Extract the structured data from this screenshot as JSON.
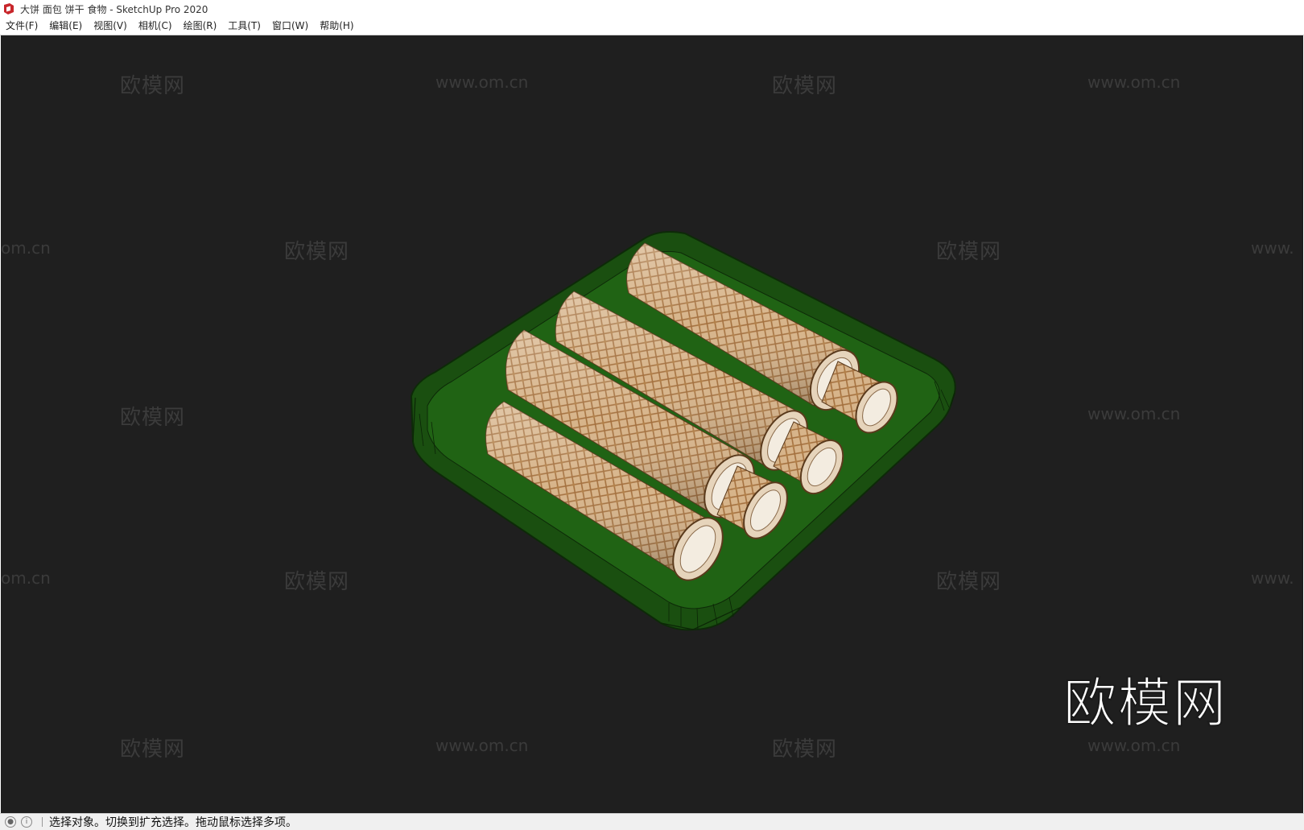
{
  "window": {
    "title": "大饼 面包 饼干 食物 - SketchUp Pro 2020",
    "app_icon": "sketchup-icon",
    "accent_color": "#c8262b"
  },
  "menu": {
    "items": [
      {
        "label": "文件(F)"
      },
      {
        "label": "编辑(E)"
      },
      {
        "label": "视图(V)"
      },
      {
        "label": "相机(C)"
      },
      {
        "label": "绘图(R)"
      },
      {
        "label": "工具(T)"
      },
      {
        "label": "窗口(W)"
      },
      {
        "label": "帮助(H)"
      }
    ]
  },
  "viewport": {
    "background": "#1f1f1f",
    "model": {
      "tray_color": "#1e5a12",
      "roll_color": "#c9a27a"
    },
    "watermarks": {
      "brand": "欧模网",
      "url": "www.om.cn",
      "url_partial": "om.cn",
      "url_prefix": "www."
    }
  },
  "statusbar": {
    "icons": [
      "geo-location-icon",
      "info-icon"
    ],
    "texts": [
      "选择对象。切换到扩充选择。拖动鼠标选择多项。"
    ]
  }
}
